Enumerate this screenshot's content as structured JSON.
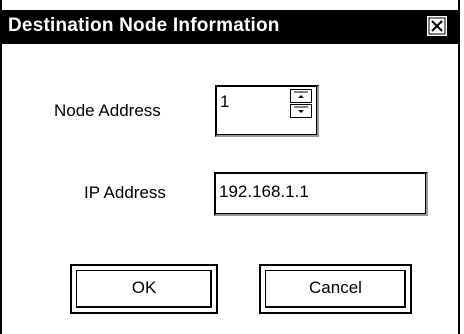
{
  "dialog": {
    "title": "Destination Node Information",
    "close_icon": "close-icon"
  },
  "node_address": {
    "label": "Node Address",
    "value": "1",
    "spin_up_icon": "spin-up-icon",
    "spin_down_icon": "spin-down-icon"
  },
  "ip_address": {
    "label": "IP Address",
    "value": "192.168.1.1"
  },
  "buttons": {
    "ok_label": "OK",
    "cancel_label": "Cancel"
  }
}
